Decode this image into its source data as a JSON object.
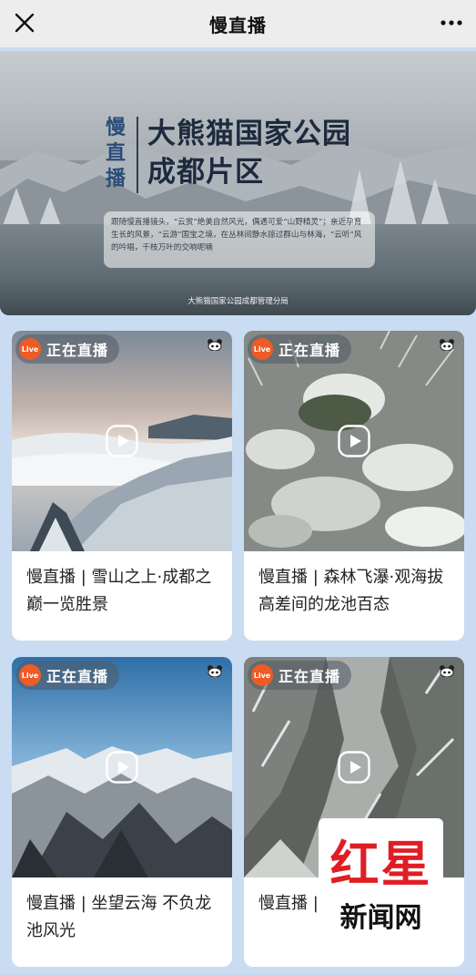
{
  "header": {
    "title": "慢直播",
    "close_icon": "close-icon",
    "more_icon": "more-dots-icon"
  },
  "banner": {
    "vertical_title": "慢直播",
    "title_line1": "大熊猫国家公园",
    "title_line2": "成都片区",
    "description": "跟随慢直播镜头，“云赏”绝美自然风光，偶遇可爱“山野精灵”；亲近孕育生长的风景，“云游”国宝之境，在丛林间静水掠过群山与林海，“云听”风的吟唱，千枝万叶的交响呢喃",
    "footer": "大熊猫国家公园成都管理分局"
  },
  "cards": [
    {
      "live_label": "正在直播",
      "live_badge": "Live",
      "caption": "慢直播 | 雪山之上·成都之巅一览胜景"
    },
    {
      "live_label": "正在直播",
      "live_badge": "Live",
      "caption": "慢直播 | 森林飞瀑·观海拔高差间的龙池百态"
    },
    {
      "live_label": "正在直播",
      "live_badge": "Live",
      "caption": "慢直播 | 坐望云海 不负龙池风光"
    },
    {
      "live_label": "正在直播",
      "live_badge": "Live",
      "caption": "慢直播 | 红星龙沟高"
    }
  ],
  "watermark": {
    "logo_text": "红星",
    "sub_text": "新闻网"
  },
  "colors": {
    "live_orange": "#ef5b25",
    "page_bg": "#c9dcf2",
    "watermark_red": "#e01d25"
  }
}
